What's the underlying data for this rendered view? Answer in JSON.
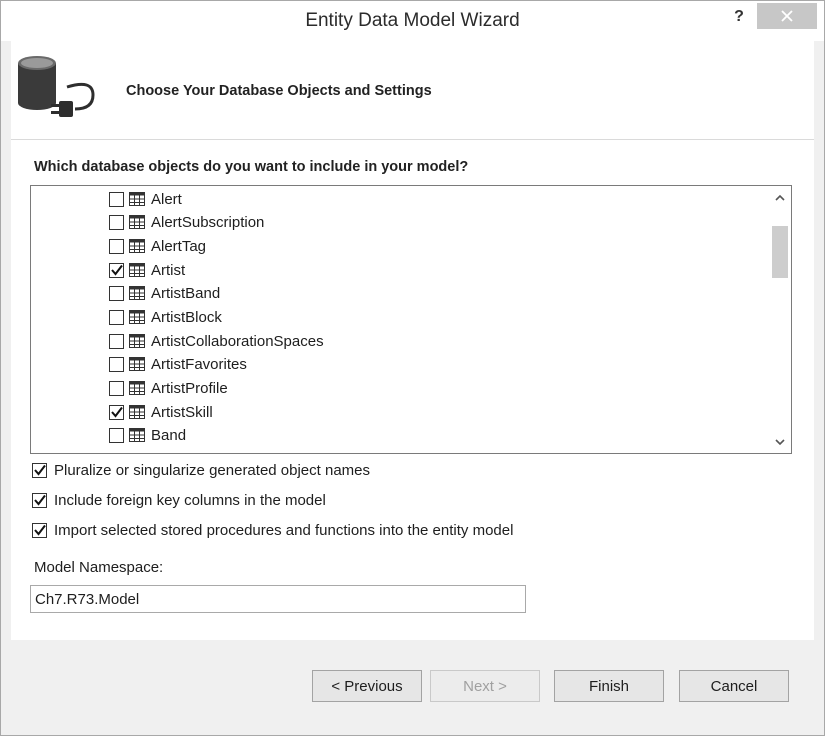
{
  "window": {
    "title": "Entity Data Model Wizard",
    "help_label": "?"
  },
  "header": {
    "title": "Choose Your Database Objects and Settings",
    "icon": "database-plug-icon"
  },
  "tree": {
    "question": "Which database objects do you want to include in your model?",
    "items": [
      {
        "label": "Alert",
        "checked": false
      },
      {
        "label": "AlertSubscription",
        "checked": false
      },
      {
        "label": "AlertTag",
        "checked": false
      },
      {
        "label": "Artist",
        "checked": true
      },
      {
        "label": "ArtistBand",
        "checked": false
      },
      {
        "label": "ArtistBlock",
        "checked": false
      },
      {
        "label": "ArtistCollaborationSpaces",
        "checked": false
      },
      {
        "label": "ArtistFavorites",
        "checked": false
      },
      {
        "label": "ArtistProfile",
        "checked": false
      },
      {
        "label": "ArtistSkill",
        "checked": true
      },
      {
        "label": "Band",
        "checked": false
      }
    ]
  },
  "options": [
    {
      "label": "Pluralize or singularize generated object names",
      "checked": true
    },
    {
      "label": "Include foreign key columns in the model",
      "checked": true
    },
    {
      "label": "Import selected stored procedures and functions into the entity model",
      "checked": true
    }
  ],
  "namespace": {
    "label": "Model Namespace:",
    "value": "Ch7.R73.Model"
  },
  "buttons": {
    "previous": "< Previous",
    "next": "Next >",
    "finish": "Finish",
    "cancel": "Cancel"
  }
}
